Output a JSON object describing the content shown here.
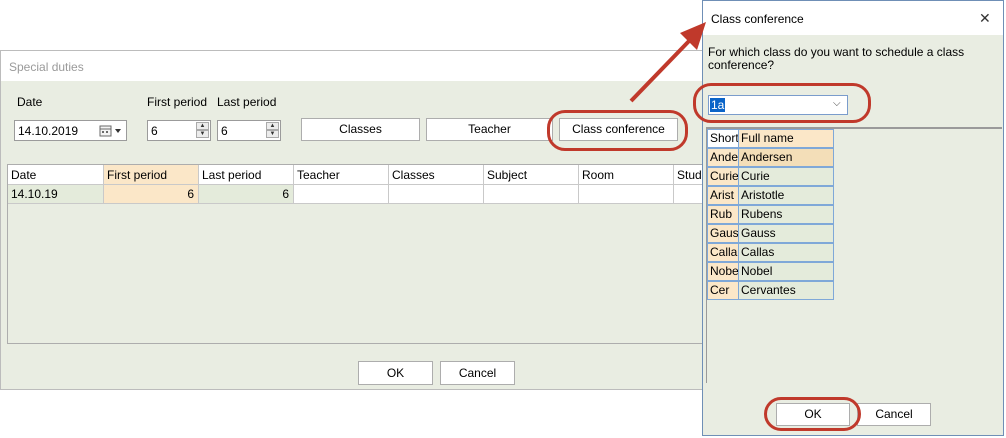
{
  "special_duties": {
    "title": "Special duties",
    "date_label": "Date",
    "first_period_label": "First period",
    "last_period_label": "Last period",
    "date_value": "14.10.2019",
    "first_period_value": "6",
    "last_period_value": "6",
    "buttons": {
      "classes": "Classes",
      "teacher": "Teacher",
      "class_conference": "Class conference",
      "ok": "OK",
      "cancel": "Cancel"
    },
    "grid": {
      "headers": [
        "Date",
        "First period",
        "Last period",
        "Teacher",
        "Classes",
        "Subject",
        "Room",
        "Stude"
      ],
      "rows": [
        {
          "date": "14.10.19",
          "first": "6",
          "last": "6",
          "teacher": "",
          "classes": "",
          "subject": "",
          "room": "",
          "stude": ""
        }
      ]
    }
  },
  "class_conference": {
    "title": "Class conference",
    "close_glyph": "✕",
    "question": "For which class do you want to schedule a class conference?",
    "combo_value": "1a",
    "list_headers": [
      "Short",
      "Full name"
    ],
    "list_rows": [
      {
        "short": "Ande",
        "full": "Andersen"
      },
      {
        "short": "Curie",
        "full": "Curie"
      },
      {
        "short": "Arist",
        "full": "Aristotle"
      },
      {
        "short": "Rub",
        "full": "Rubens"
      },
      {
        "short": "Gaus",
        "full": "Gauss"
      },
      {
        "short": "Calla",
        "full": "Callas"
      },
      {
        "short": "Nobe",
        "full": "Nobel"
      },
      {
        "short": "Cer",
        "full": "Cervantes"
      }
    ],
    "ok": "OK",
    "cancel": "Cancel"
  },
  "annotation_color": "#c0392b"
}
